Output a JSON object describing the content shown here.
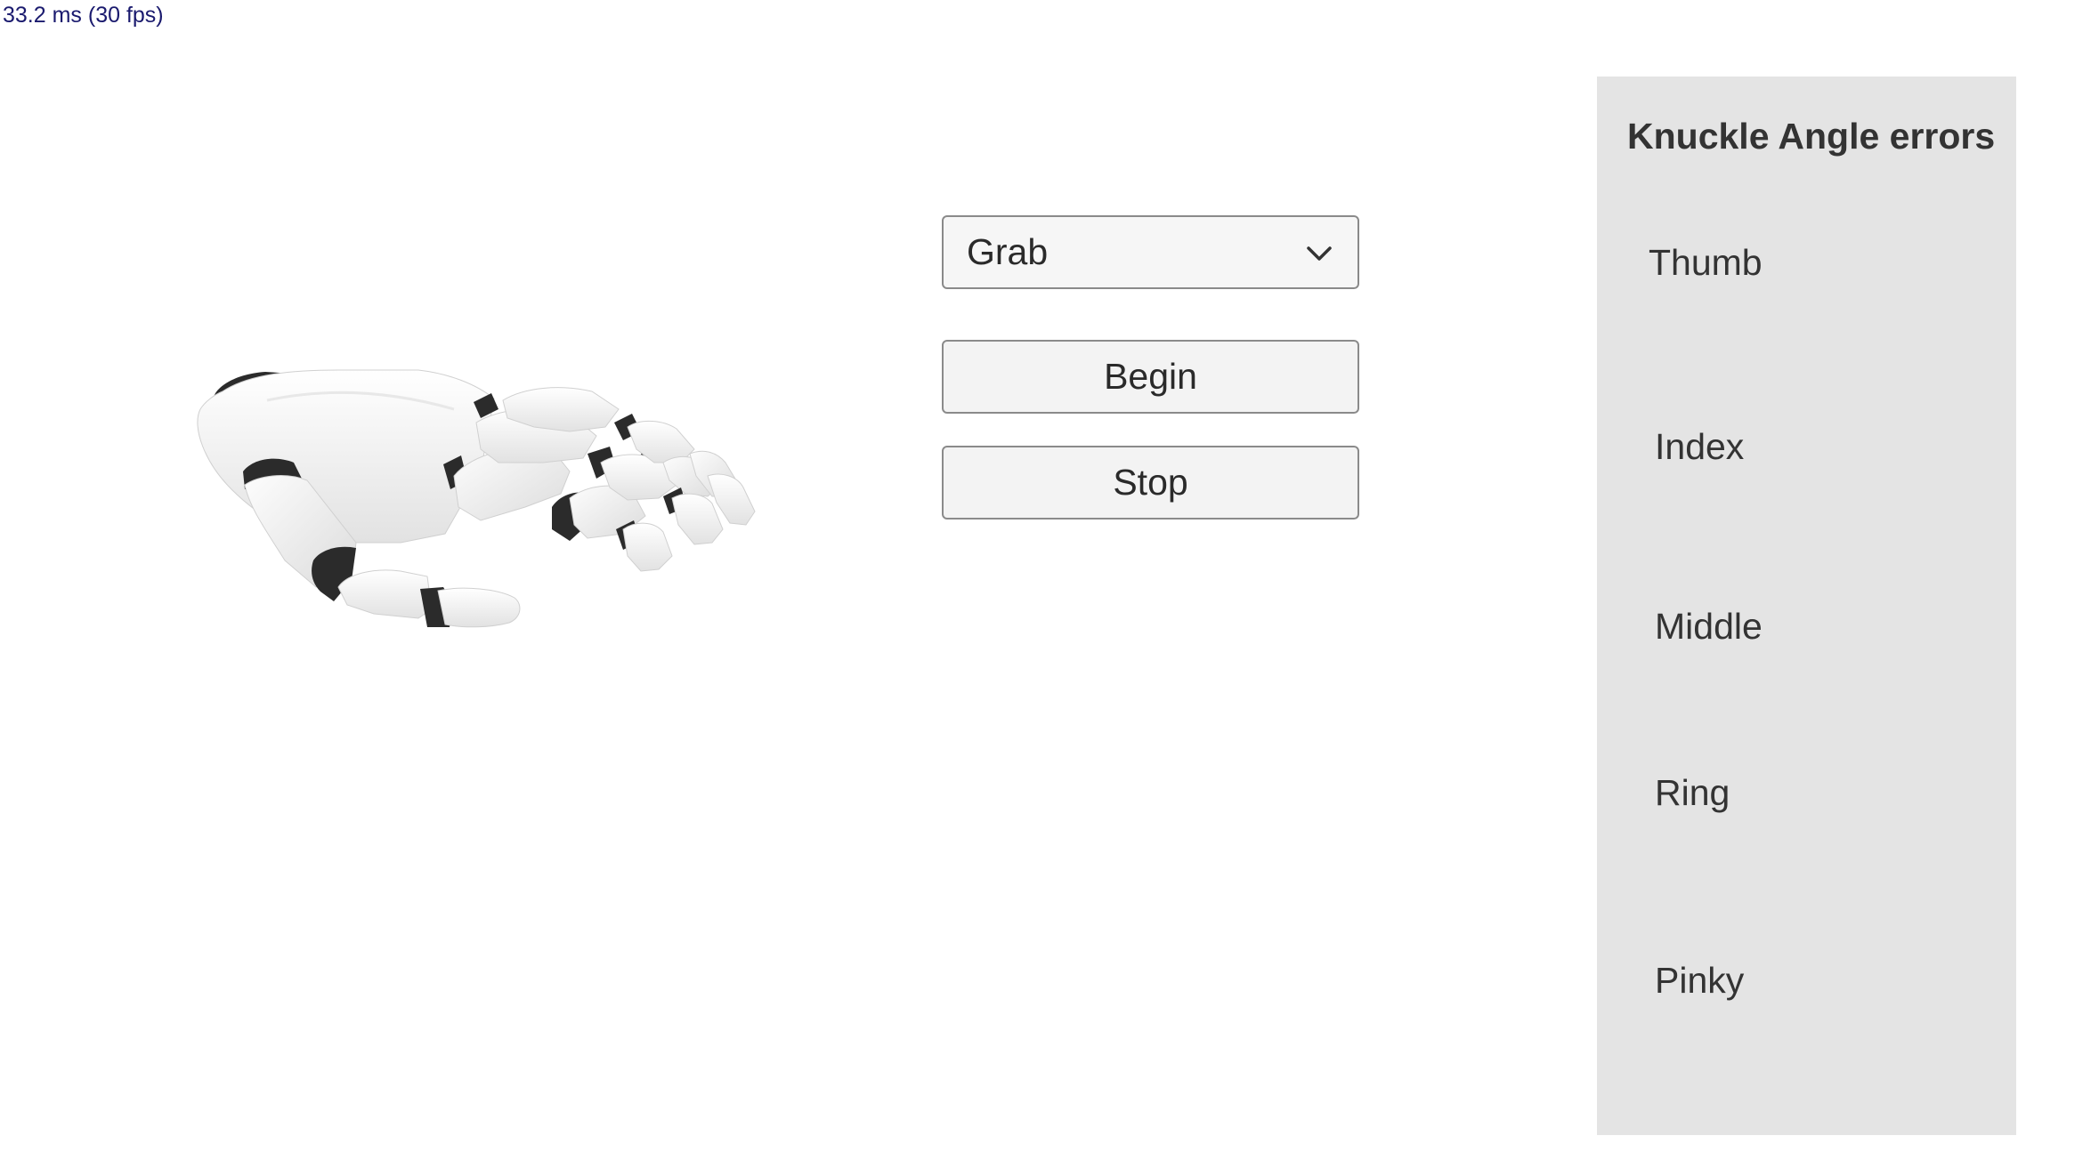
{
  "status": {
    "frame_time": "33.2 ms (30 fps)"
  },
  "viewport": {
    "model": "robotic-hand"
  },
  "controls": {
    "gesture_select": {
      "selected": "Grab"
    },
    "begin_label": "Begin",
    "stop_label": "Stop"
  },
  "panel": {
    "title": "Knuckle Angle errors",
    "fingers": [
      "Thumb",
      "Index",
      "Middle",
      "Ring",
      "Pinky"
    ]
  },
  "colors": {
    "panel_bg": "#e4e4e4",
    "button_bg": "#f3f3f3",
    "button_border": "#8a8a8a",
    "fps_text": "#1a1a6e",
    "hand_joint": "#2b2b2b",
    "hand_shell": "#f2f2f2"
  }
}
